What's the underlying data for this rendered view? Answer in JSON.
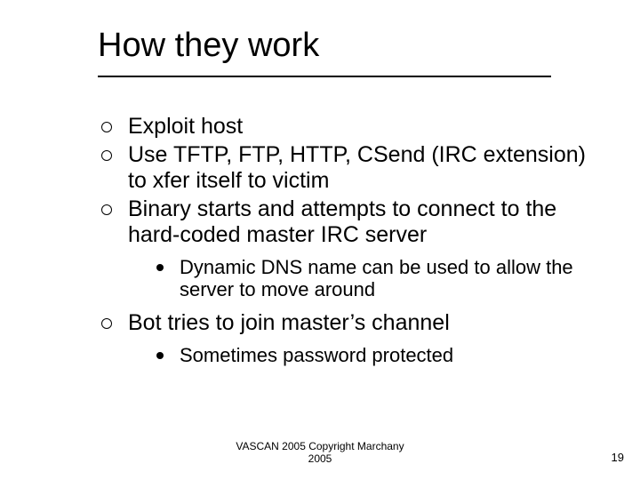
{
  "title": "How they work",
  "bullets": [
    {
      "text": "Exploit host",
      "sub": []
    },
    {
      "text": "Use TFTP, FTP, HTTP, CSend (IRC extension) to xfer itself to victim",
      "sub": []
    },
    {
      "text": "Binary starts and attempts to connect to the hard-coded master IRC server",
      "sub": [
        "Dynamic DNS name can be used to allow the server to move around"
      ]
    },
    {
      "text": "Bot tries to join master’s channel",
      "sub": [
        "Sometimes password protected"
      ]
    }
  ],
  "footer": {
    "line1": "VASCAN 2005 Copyright Marchany",
    "line2": "2005"
  },
  "page_number": "19"
}
